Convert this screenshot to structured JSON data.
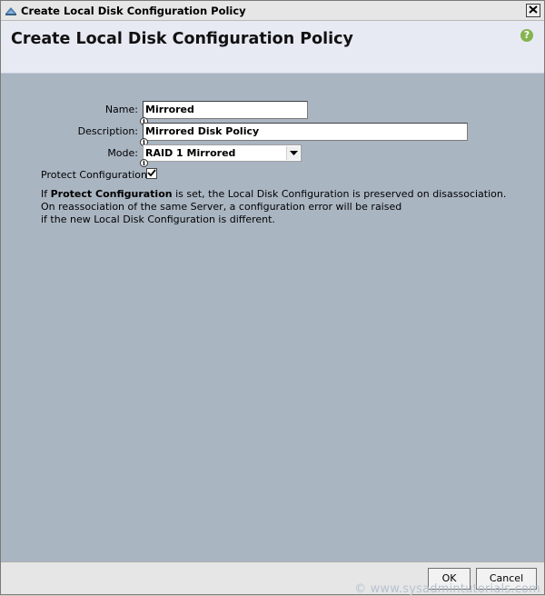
{
  "window": {
    "title": "Create Local Disk Configuration Policy"
  },
  "header": {
    "title": "Create Local Disk Configuration Policy",
    "help_icon_label": "?"
  },
  "form": {
    "name_label": "Name:",
    "name_value": "Mirrored",
    "description_label": "Description:",
    "description_value": "Mirrored Disk Policy",
    "mode_label": "Mode:",
    "mode_value": "RAID 1 Mirrored",
    "protect_label": "Protect Configuration:",
    "protect_checked": true,
    "info_glyph": "i"
  },
  "info": {
    "line1_prefix": "If ",
    "line1_bold": "Protect Configuration",
    "line1_suffix": " is set, the Local Disk Configuration is preserved on disassociation.",
    "line2": "On reassociation of the same Server, a configuration error will be raised",
    "line3": "if the new Local Disk Configuration is different."
  },
  "footer": {
    "ok_label": "OK",
    "cancel_label": "Cancel",
    "watermark": "© www.sysadmintutorials.com"
  },
  "icons": {
    "title_icon": "cisco-app-icon",
    "close": "close-icon",
    "help": "help-icon",
    "dropdown": "chevron-down-icon",
    "info": "info-icon",
    "check": "checkmark-icon"
  },
  "colors": {
    "body_bg": "#aab5c2",
    "header_bg": "#e8eaf3",
    "help_green": "#84b450"
  }
}
